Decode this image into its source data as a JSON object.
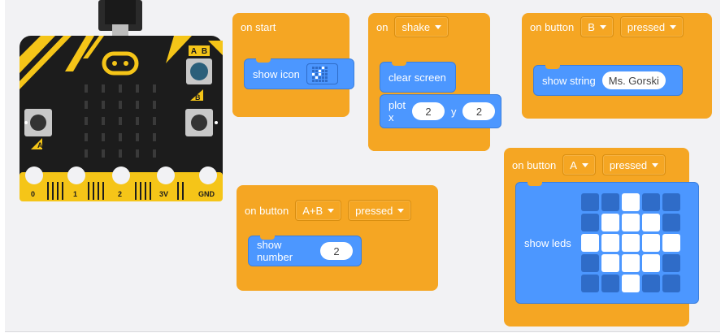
{
  "microbit": {
    "pin_labels": [
      "0",
      "1",
      "2",
      "3V",
      "GND"
    ],
    "button_a_label": "A",
    "button_b_label": "B",
    "button_ab_label": "A B",
    "colors": {
      "board": "#1c1c1c",
      "accent": "#f5c518",
      "usb": "#444444"
    }
  },
  "blocks": {
    "on_start": {
      "label": "on start",
      "statement": {
        "label": "show icon",
        "icon": "small-grid-icon"
      }
    },
    "on_shake": {
      "label": "on",
      "gesture": "shake",
      "statements": [
        {
          "label": "clear screen"
        },
        {
          "label": "plot x",
          "x_label": "x",
          "x": "2",
          "y_label": "y",
          "y": "2"
        }
      ]
    },
    "on_button_b": {
      "label": "on button",
      "button": "B",
      "event": "pressed",
      "statement": {
        "label": "show string",
        "value": "Ms. Gorski"
      }
    },
    "on_button_ab": {
      "label": "on button",
      "button": "A+B",
      "event": "pressed",
      "statement": {
        "label": "show number",
        "value": "2"
      }
    },
    "on_button_a": {
      "label": "on button",
      "button": "A",
      "event": "pressed",
      "statement": {
        "label": "show leds",
        "leds": [
          [
            0,
            0,
            1,
            0,
            0
          ],
          [
            0,
            1,
            1,
            1,
            0
          ],
          [
            1,
            1,
            1,
            1,
            1
          ],
          [
            0,
            1,
            1,
            1,
            0
          ],
          [
            0,
            0,
            1,
            0,
            0
          ]
        ]
      }
    }
  },
  "colors": {
    "event_block": "#f5a623",
    "statement_block": "#4c97ff",
    "workspace": "#f2f2f4"
  }
}
